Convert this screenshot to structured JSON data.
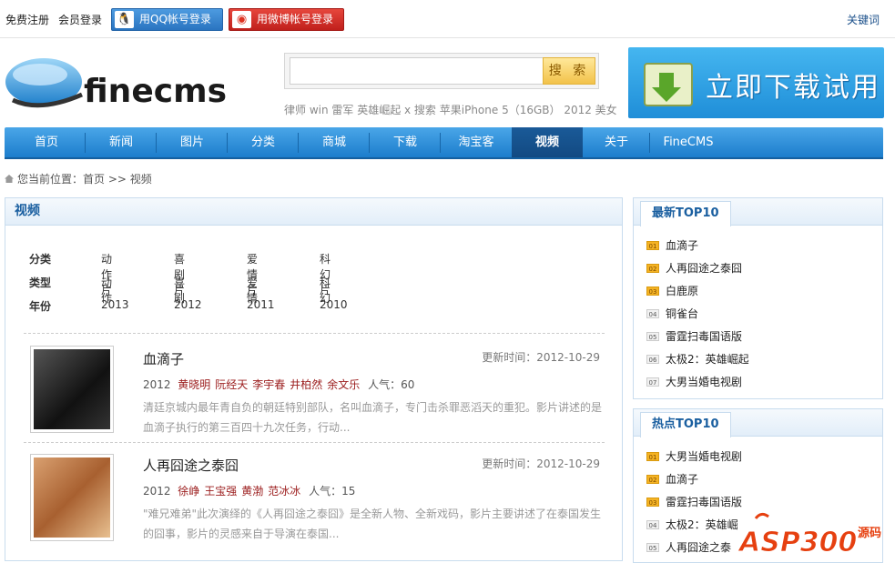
{
  "topbar": {
    "register": "免费注册",
    "login": "会员登录",
    "qq_login": "用QQ帐号登录",
    "weibo_login": "用微博帐号登录",
    "keywords": "关键词"
  },
  "logo": {
    "text": "finecms"
  },
  "search": {
    "button": "搜 索",
    "hot": "律师 win 雷军 英雄崛起 x 搜索 苹果iPhone 5（16GB） 2012 美女"
  },
  "download": {
    "label": "立即下载试用"
  },
  "nav": {
    "items": [
      "首页",
      "新闻",
      "图片",
      "分类",
      "商城",
      "下载",
      "淘宝客",
      "视频",
      "关于",
      "FineCMS"
    ],
    "active": "视频"
  },
  "breadcrumb": "您当前位置：首页 >> 视频",
  "main": {
    "title": "视频",
    "filters": [
      {
        "label": "分类",
        "options": [
          "动作片",
          "喜剧片",
          "爱情片",
          "科幻片"
        ]
      },
      {
        "label": "类型",
        "options": [
          "动作",
          "喜剧",
          "爱情",
          "科幻"
        ]
      },
      {
        "label": "年份",
        "options": [
          "2013",
          "2012",
          "2011",
          "2010"
        ]
      }
    ],
    "items": [
      {
        "title": "血滴子",
        "time": "更新时间：2012-10-29",
        "year": "2012",
        "actors": [
          "黄晓明",
          "阮经天",
          "李宇春",
          "井柏然",
          "余文乐"
        ],
        "pop": "人气：60",
        "desc": "清廷京城内最年青自负的朝廷特别部队，名叫血滴子，专门击杀罪恶滔天的重犯。影片讲述的是血滴子执行的第三百四十九次任务，行动..."
      },
      {
        "title": "人再囧途之泰囧",
        "time": "更新时间：2012-10-29",
        "year": "2012",
        "actors": [
          "徐峥",
          "王宝强",
          "黄渤",
          "范冰冰"
        ],
        "pop": "人气：15",
        "desc": "\"难兄难弟\"此次演绎的《人再囧途之泰囧》是全新人物、全新戏码，影片主要讲述了在泰国发生的囧事，影片的灵感来自于导演在泰国..."
      }
    ]
  },
  "latest": {
    "title": "最新TOP10",
    "items": [
      {
        "num": "01",
        "text": "血滴子"
      },
      {
        "num": "02",
        "text": "人再囧途之泰囧"
      },
      {
        "num": "03",
        "text": "白鹿原"
      },
      {
        "num": "04",
        "text": "铜雀台"
      },
      {
        "num": "05",
        "text": "雷霆扫毒国语版"
      },
      {
        "num": "06",
        "text": "太极2：英雄崛起"
      },
      {
        "num": "07",
        "text": "大男当婚电视剧"
      }
    ]
  },
  "hot": {
    "title": "热点TOP10",
    "items": [
      {
        "num": "01",
        "text": "大男当婚电视剧"
      },
      {
        "num": "02",
        "text": "血滴子"
      },
      {
        "num": "03",
        "text": "雷霆扫毒国语版"
      },
      {
        "num": "04",
        "text": "太极2：英雄崛"
      },
      {
        "num": "05",
        "text": "人再囧途之泰"
      }
    ]
  },
  "watermark": {
    "brand": "ASP300",
    "suffix": "源码"
  }
}
